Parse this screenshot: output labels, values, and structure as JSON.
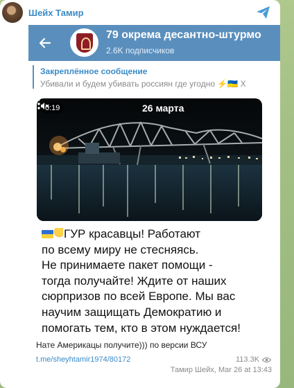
{
  "post": {
    "author": "Шейх Тамир",
    "tail_text": "Нате Америкацы получите))) по версии ВСУ",
    "link": "t.me/sheyhtamir1974/80172",
    "views": "113.3K",
    "meta": "Тамир Шейх, Mar 26 at 13:43"
  },
  "embed": {
    "channel_title": "79 окрема десантно-штурмо",
    "channel_subscribers": "2.6K подписчиков",
    "pinned_title": "Закреплённое сообщение",
    "pinned_text": "Убивали и будем убивать россиян где угодно ⚡🇺🇦 Х"
  },
  "video": {
    "time": "0:19",
    "date": "26 марта"
  },
  "caption": {
    "line1": "ГУР красавцы! Работают",
    "line2": "по всему миру не стесняясь.",
    "line3": "Не принимаете пакет помощи -",
    "line4": "тогда получайте! Ждите от наших",
    "line5": "сюрпризов по всей Европе. Мы вас",
    "line6": "научим защищать Демократию и",
    "line7": "помогать тем, кто в этом нуждается!"
  },
  "colors": {
    "accent": "#3a8bc7",
    "channel_bar": "#5a8fbd",
    "background": "#a9c489"
  },
  "icons": [
    "share-icon",
    "back-arrow-icon",
    "mute-icon",
    "more-vertical-icon",
    "eye-icon"
  ]
}
